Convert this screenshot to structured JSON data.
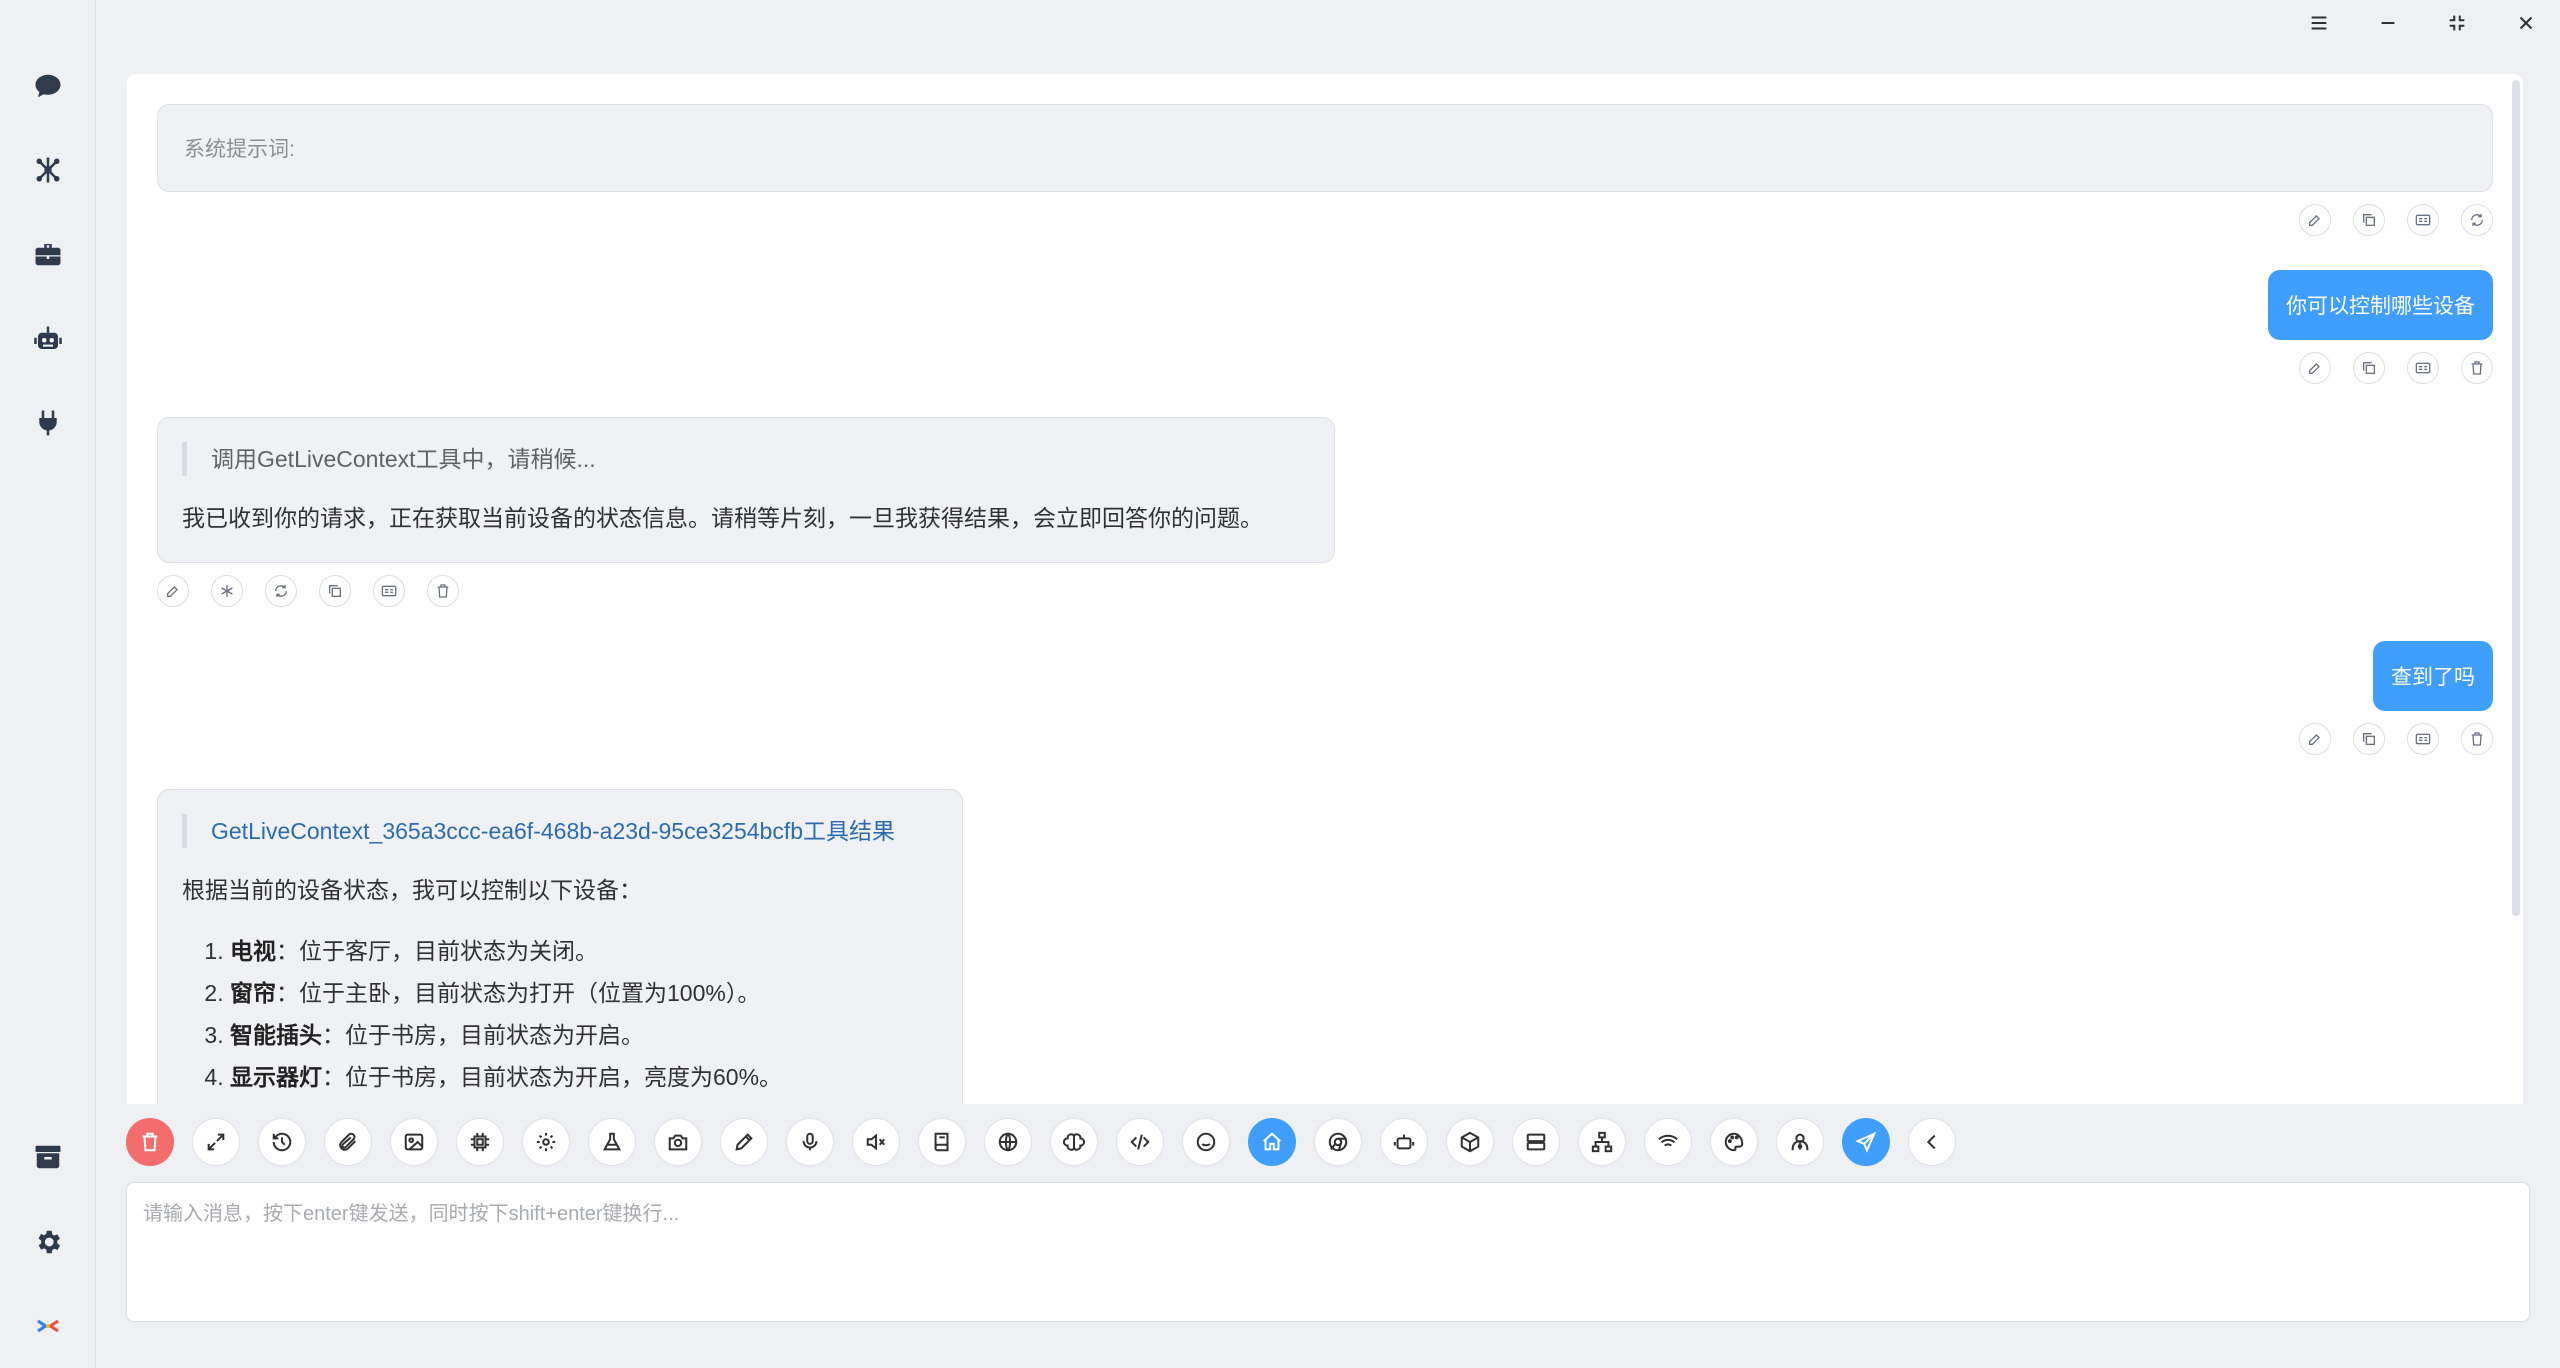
{
  "system_prompt": {
    "label": "系统提示词:"
  },
  "messages": {
    "user1": "你可以控制哪些设备",
    "bot1": {
      "quote": "调用GetLiveContext工具中，请稍候...",
      "text": "我已收到你的请求，正在获取当前设备的状态信息。请稍等片刻，一旦我获得结果，会立即回答你的问题。"
    },
    "user2": "查到了吗",
    "bot2": {
      "quote": "GetLiveContext_365a3ccc-ea6f-468b-a23d-95ce3254bcfb工具结果",
      "intro": "根据当前的设备状态，我可以控制以下设备：",
      "items": [
        {
          "name": "电视",
          "desc": "：位于客厅，目前状态为关闭。"
        },
        {
          "name": "窗帘",
          "desc": "：位于主卧，目前状态为打开（位置为100%）。"
        },
        {
          "name": "智能插头",
          "desc": "：位于书房，目前状态为开启。"
        },
        {
          "name": "显示器灯",
          "desc": "：位于书房，目前状态为开启，亮度为60%。"
        }
      ]
    }
  },
  "input": {
    "placeholder": "请输入消息，按下enter键发送，同时按下shift+enter键换行..."
  },
  "colors": {
    "accent": "#409eff",
    "danger": "#f56c6c",
    "background": "#eef0f4"
  },
  "icons": {
    "sidebar_top": [
      "chat-icon",
      "network-icon",
      "toolbox-icon",
      "robot-icon",
      "plug-icon"
    ],
    "sidebar_bottom": [
      "archive-icon",
      "settings-icon",
      "app-logo-icon"
    ],
    "toolbar": [
      "delete-icon",
      "expand-icon",
      "history-icon",
      "attachment-icon",
      "image-icon",
      "chip-icon",
      "gear-icon",
      "flask-icon",
      "camera-icon",
      "pencil-icon",
      "microphone-icon",
      "mute-icon",
      "book-icon",
      "globe-icon",
      "brain-icon",
      "code-icon",
      "emoji-icon",
      "home-icon",
      "chrome-icon",
      "robot-icon",
      "cube-icon",
      "server-icon",
      "sitemap-icon",
      "wifi-icon",
      "palette-icon",
      "user-tie-icon",
      "send-icon",
      "collapse-icon"
    ]
  }
}
